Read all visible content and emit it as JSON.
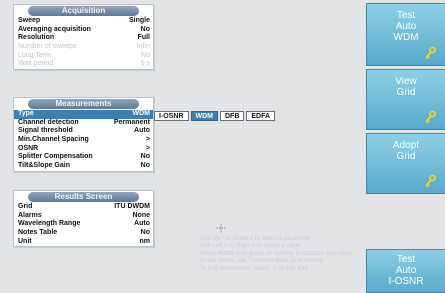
{
  "acquisition": {
    "title": "Acquisition",
    "rows": [
      {
        "label": "Sweep",
        "value": "Single"
      },
      {
        "label": "Averaging acquisition",
        "value": "No"
      },
      {
        "label": "Resolution",
        "value": "Full"
      },
      {
        "label": "Number of sweeps",
        "value": "Infin"
      },
      {
        "label": "Long Term",
        "value": "No"
      },
      {
        "label": "Wait period",
        "value": "5 s"
      }
    ]
  },
  "measurements": {
    "title": "Measurements",
    "rows": [
      {
        "label": "Type",
        "value": "WDM"
      },
      {
        "label": "Channel detection",
        "value": "Permanent"
      },
      {
        "label": "Signal threshold",
        "value": "Auto"
      },
      {
        "label": "Min.Channel Spacing",
        "value": ">"
      },
      {
        "label": "OSNR",
        "value": ">"
      },
      {
        "label": "Splitter Compensation",
        "value": "No"
      },
      {
        "label": "Tilt&Slope Gain",
        "value": "No"
      }
    ]
  },
  "results": {
    "title": "Results Screen",
    "rows": [
      {
        "label": "Grid",
        "value": "ITU DWDM"
      },
      {
        "label": "Alarms",
        "value": "None"
      },
      {
        "label": "Wavelength Range",
        "value": "Auto"
      },
      {
        "label": "Notes Table",
        "value": "No"
      },
      {
        "label": "Unit",
        "value": "nm"
      }
    ]
  },
  "type_options": [
    "I-OSNR",
    "WDM",
    "DFB",
    "EDFA"
  ],
  "type_selected": "WDM",
  "side_buttons": [
    {
      "label_lines": [
        "Test",
        "Auto",
        "WDM"
      ],
      "icon": "key-icon"
    },
    {
      "label_lines": [
        "View",
        "Grid"
      ],
      "icon": "key-icon"
    },
    {
      "label_lines": [
        "Adopt",
        "Grid"
      ],
      "icon": "key-icon"
    },
    {
      "label_lines": [
        "Test",
        "Auto",
        "I-OSNR"
      ],
      "icon": ""
    }
  ],
  "help_lines": [
    "Use Up ^ or Down v to select a parameter",
    "Use Left < or Right > to select a value",
    "When Middle Key green on softkey, it validates sub-menu",
    "In sub-menu, use ^ to move back up to the top",
    "To edit text/number, select -> or Edit Key"
  ],
  "colors": {
    "selection": "#3a80b3",
    "side_button": "#6fbcd9",
    "panel_header": "#6f8aa5",
    "disabled_text": "#c2c6ca"
  }
}
